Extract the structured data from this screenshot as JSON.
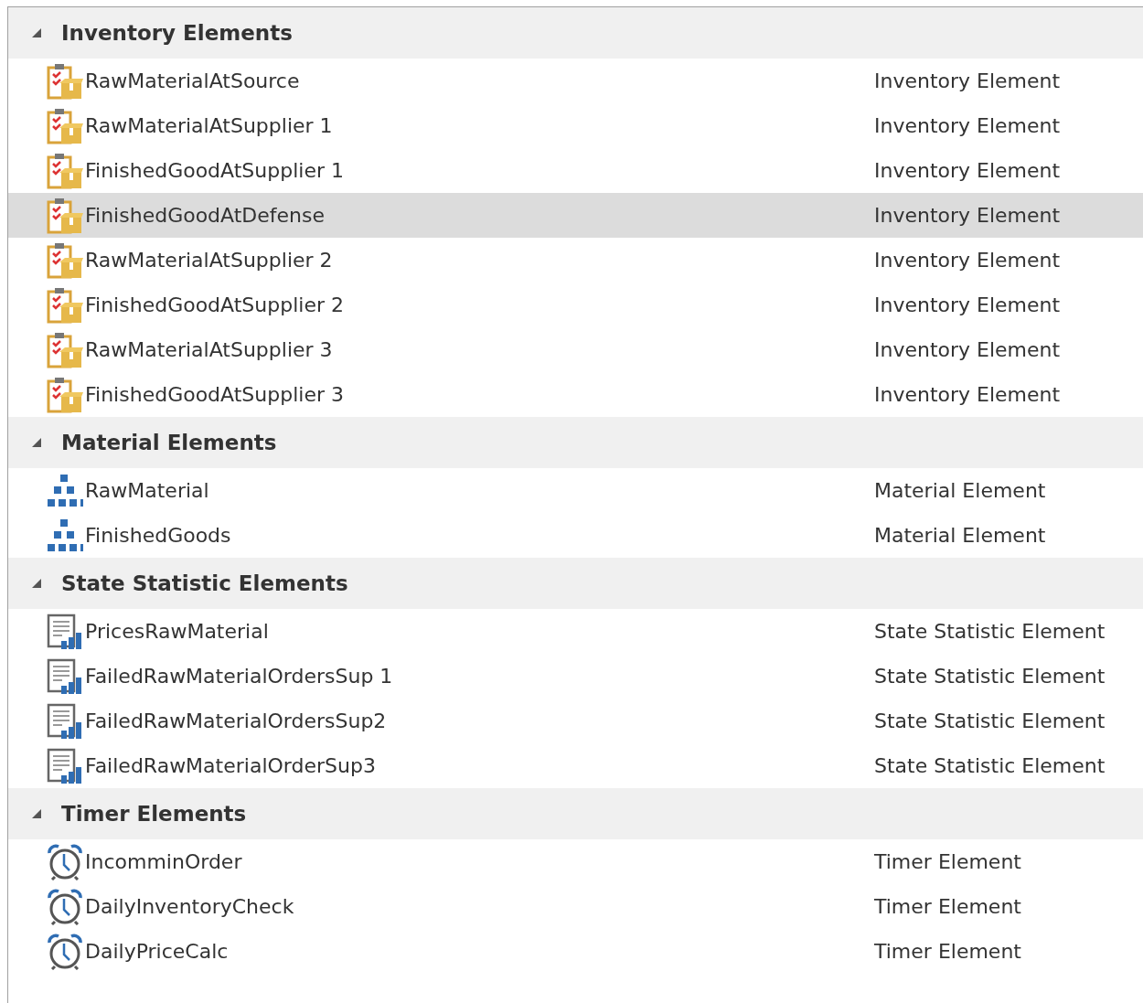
{
  "groups": [
    {
      "title": "Inventory Elements",
      "kind": "inventory",
      "expanded": true,
      "items": [
        {
          "name": "RawMaterialAtSource",
          "type": "Inventory Element",
          "selected": false
        },
        {
          "name": "RawMaterialAtSupplier 1",
          "type": "Inventory Element",
          "selected": false
        },
        {
          "name": "FinishedGoodAtSupplier 1",
          "type": "Inventory Element",
          "selected": false
        },
        {
          "name": "FinishedGoodAtDefense",
          "type": "Inventory Element",
          "selected": true
        },
        {
          "name": "RawMaterialAtSupplier 2",
          "type": "Inventory Element",
          "selected": false
        },
        {
          "name": "FinishedGoodAtSupplier 2",
          "type": "Inventory Element",
          "selected": false
        },
        {
          "name": "RawMaterialAtSupplier 3",
          "type": "Inventory Element",
          "selected": false
        },
        {
          "name": "FinishedGoodAtSupplier 3",
          "type": "Inventory Element",
          "selected": false
        }
      ]
    },
    {
      "title": "Material Elements",
      "kind": "material",
      "expanded": true,
      "items": [
        {
          "name": "RawMaterial",
          "type": "Material Element",
          "selected": false
        },
        {
          "name": "FinishedGoods",
          "type": "Material Element",
          "selected": false
        }
      ]
    },
    {
      "title": "State Statistic Elements",
      "kind": "statistic",
      "expanded": true,
      "items": [
        {
          "name": "PricesRawMaterial",
          "type": "State Statistic Element",
          "selected": false
        },
        {
          "name": "FailedRawMaterialOrdersSup 1",
          "type": "State Statistic Element",
          "selected": false
        },
        {
          "name": "FailedRawMaterialOrdersSup2",
          "type": "State Statistic Element",
          "selected": false
        },
        {
          "name": "FailedRawMaterialOrderSup3",
          "type": "State Statistic Element",
          "selected": false
        }
      ]
    },
    {
      "title": "Timer Elements",
      "kind": "timer",
      "expanded": true,
      "items": [
        {
          "name": "IncomminOrder",
          "type": "Timer Element",
          "selected": false
        },
        {
          "name": "DailyInventoryCheck",
          "type": "Timer Element",
          "selected": false
        },
        {
          "name": "DailyPriceCalc",
          "type": "Timer Element",
          "selected": false
        }
      ]
    }
  ]
}
